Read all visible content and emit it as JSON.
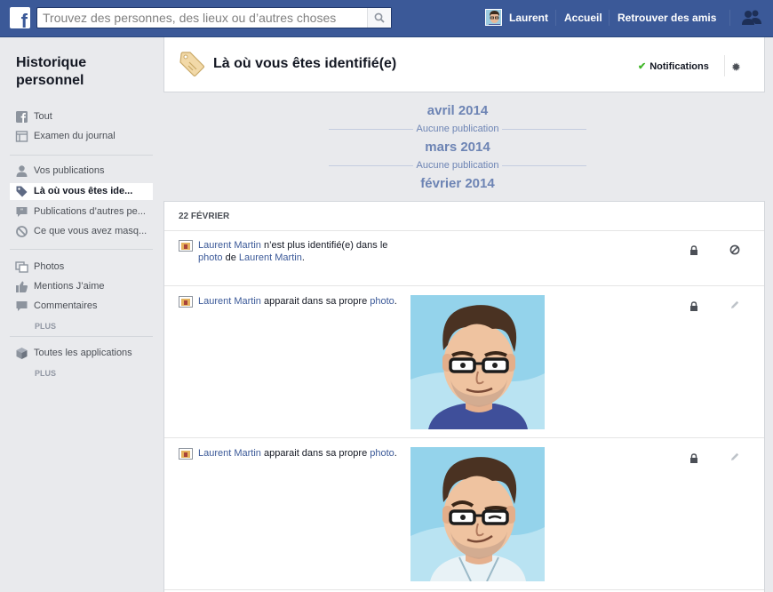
{
  "topbar": {
    "search_placeholder": "Trouvez des personnes, des lieux ou d’autres choses",
    "user_name": "Laurent",
    "home_label": "Accueil",
    "find_friends_label": "Retrouver des amis"
  },
  "sidebar": {
    "title": "Historique personnel",
    "items": [
      {
        "label": "Tout",
        "icon": "facebook-icon"
      },
      {
        "label": "Examen du journal",
        "icon": "timeline-icon"
      },
      {
        "label": "Vos publications",
        "icon": "person-icon"
      },
      {
        "label": "Là où vous êtes ide...",
        "icon": "tag-icon",
        "active": true
      },
      {
        "label": "Publications d’autres pe...",
        "icon": "speech-bubble-icon"
      },
      {
        "label": "Ce que vous avez masq...",
        "icon": "hidden-icon"
      },
      {
        "label": "Photos",
        "icon": "photos-icon"
      },
      {
        "label": "Mentions J’aime",
        "icon": "like-icon"
      },
      {
        "label": "Commentaires",
        "icon": "comment-icon"
      },
      {
        "label": "Toutes les applications",
        "icon": "apps-icon"
      }
    ],
    "more_label": "PLUS"
  },
  "header": {
    "title": "Là où vous êtes identifié(e)",
    "notifications_label": "Notifications"
  },
  "timeline": {
    "months": [
      {
        "label": "avril 2014",
        "note": "Aucune publication"
      },
      {
        "label": "mars 2014",
        "note": "Aucune publication"
      },
      {
        "label": "février 2014"
      }
    ]
  },
  "activity": {
    "day_label": "22 FÉVRIER",
    "rows": [
      {
        "name": "Laurent Martin",
        "text1": " n’est plus identifié(e) dans le ",
        "link1": "photo",
        "text2": " de ",
        "name2": "Laurent Martin",
        "text3": ".",
        "action": "block-icon"
      },
      {
        "name": "Laurent Martin",
        "text1": " apparait dans sa propre ",
        "link1": "photo",
        "text2": ".",
        "action": "edit-pencil-icon"
      },
      {
        "name": "Laurent Martin",
        "text1": " apparait dans sa propre ",
        "link1": "photo",
        "text2": ".",
        "action": "edit-pencil-icon"
      }
    ]
  },
  "colors": {
    "brand_blue": "#3b5998",
    "link": "#3b5998",
    "month_text": "#6d84b4",
    "check_green": "#42b72a"
  }
}
